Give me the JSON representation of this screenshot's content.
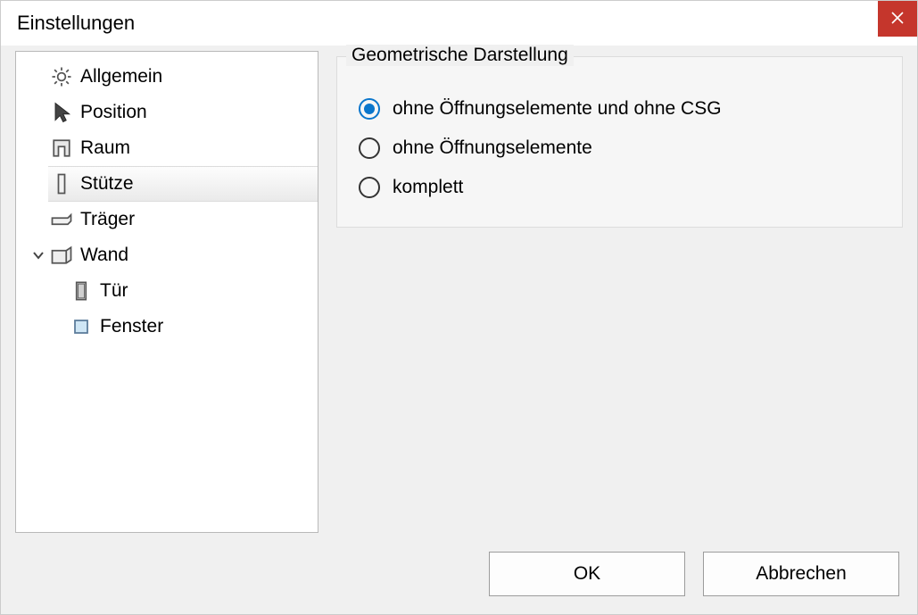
{
  "window": {
    "title": "Einstellungen"
  },
  "tree": {
    "items": [
      {
        "id": "allgemein",
        "label": "Allgemein",
        "icon": "gear-icon",
        "level": 0,
        "expandable": false,
        "selected": false
      },
      {
        "id": "position",
        "label": "Position",
        "icon": "cursor-icon",
        "level": 0,
        "expandable": false,
        "selected": false
      },
      {
        "id": "raum",
        "label": "Raum",
        "icon": "room-icon",
        "level": 0,
        "expandable": false,
        "selected": false
      },
      {
        "id": "stuetze",
        "label": "Stütze",
        "icon": "column-icon",
        "level": 0,
        "expandable": false,
        "selected": true
      },
      {
        "id": "traeger",
        "label": "Träger",
        "icon": "beam-icon",
        "level": 0,
        "expandable": false,
        "selected": false
      },
      {
        "id": "wand",
        "label": "Wand",
        "icon": "wall-icon",
        "level": 0,
        "expandable": true,
        "expanded": true,
        "selected": false
      },
      {
        "id": "tuer",
        "label": "Tür",
        "icon": "door-icon",
        "level": 1,
        "expandable": false,
        "selected": false
      },
      {
        "id": "fenster",
        "label": "Fenster",
        "icon": "window-icon",
        "level": 1,
        "expandable": false,
        "selected": false
      }
    ]
  },
  "panel": {
    "group_title": "Geometrische Darstellung",
    "radios": [
      {
        "id": "no_open_no_csg",
        "label": "ohne Öffnungselemente und ohne CSG",
        "checked": true
      },
      {
        "id": "no_open",
        "label": "ohne Öffnungselemente",
        "checked": false
      },
      {
        "id": "komplett",
        "label": "komplett",
        "checked": false
      }
    ]
  },
  "footer": {
    "ok_label": "OK",
    "cancel_label": "Abbrechen"
  }
}
